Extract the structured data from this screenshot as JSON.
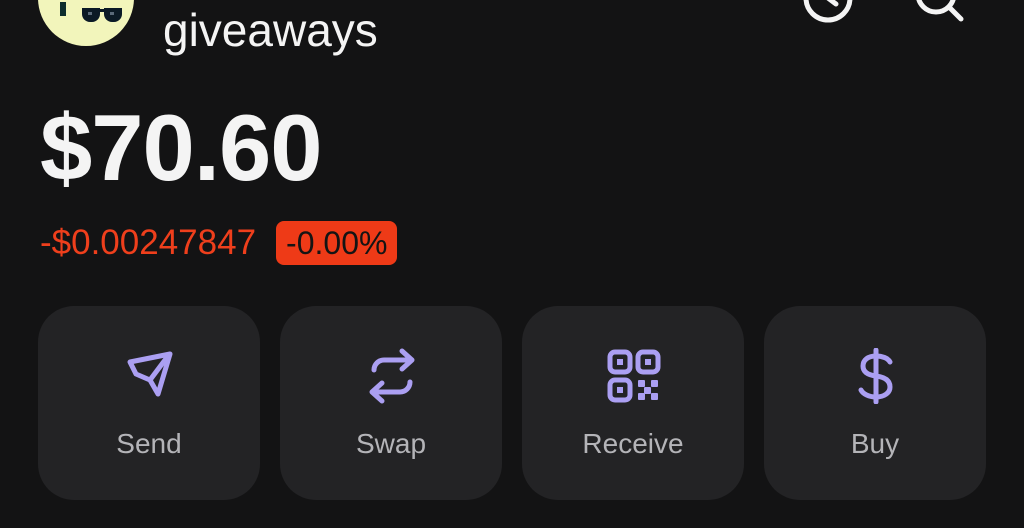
{
  "header": {
    "account_name": "giveaways",
    "avatar_icon": "avatar-icon",
    "history_icon": "clock-icon",
    "search_icon": "search-icon"
  },
  "balance": {
    "amount": "$70.60",
    "change_amount": "-$0.00247847",
    "change_percent": "-0.00%"
  },
  "actions": [
    {
      "label": "Send",
      "icon": "send-icon"
    },
    {
      "label": "Swap",
      "icon": "swap-icon"
    },
    {
      "label": "Receive",
      "icon": "qr-code-icon"
    },
    {
      "label": "Buy",
      "icon": "dollar-icon"
    }
  ],
  "colors": {
    "background": "#131314",
    "card": "#232325",
    "accent": "#ab9ff2",
    "negative": "#ef3f1c",
    "text_primary": "#f4f4f4",
    "text_secondary": "#b4b4b8"
  }
}
